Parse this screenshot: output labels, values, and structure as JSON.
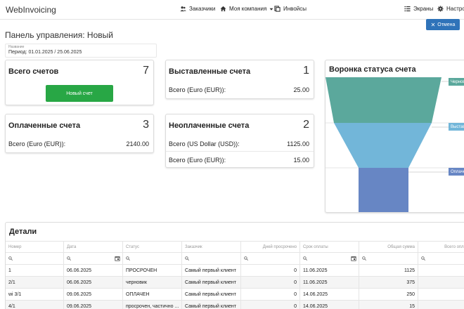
{
  "navbar": {
    "brand": "WebInvoicing",
    "items": [
      {
        "label": "Заказчики",
        "icon": "users-icon"
      },
      {
        "label": "Моя компания",
        "icon": "home-icon",
        "dropdown": true
      },
      {
        "label": "Инвойсы",
        "icon": "documents-icon"
      }
    ],
    "right_items": [
      {
        "label": "Экраны",
        "icon": "list-icon"
      },
      {
        "label": "Настрой",
        "icon": "gear-icon"
      }
    ]
  },
  "page": {
    "title": "Панель управления: Новый",
    "cancel_label": "Отмена",
    "name_field_label": "Название",
    "name_field_value": "Период: 01.01.2025 / 25.06.2025"
  },
  "cards": {
    "total": {
      "title": "Всего счетов",
      "count": "7",
      "button_label": "Новый счет"
    },
    "issued": {
      "title": "Выставленные счета",
      "count": "1",
      "rows": [
        {
          "label": "Всего (Euro (EUR)):",
          "value": "25.00"
        }
      ]
    },
    "paid": {
      "title": "Оплаченные счета",
      "count": "3",
      "rows": [
        {
          "label": "Всего (Euro (EUR)):",
          "value": "2140.00"
        }
      ]
    },
    "unpaid": {
      "title": "Неоплаченные счета",
      "count": "2",
      "rows": [
        {
          "label": "Всего (US Dollar (USD)):",
          "value": "1125.00"
        },
        {
          "label": "Всего (Euro (EUR)):",
          "value": "15.00"
        }
      ]
    }
  },
  "funnel": {
    "title": "Воронка статуса счета",
    "stages": [
      {
        "label": "Черновик",
        "color": "#5ba89c"
      },
      {
        "label": "Выставлен",
        "color": "#72b6d9"
      },
      {
        "label": "Оплачен",
        "color": "#6786c4"
      }
    ]
  },
  "details": {
    "title": "Детали",
    "columns": [
      "Номер",
      "Дата",
      "Статус",
      "Заказчик",
      "Дней просрочено",
      "Срок оплаты",
      "Общая сумма",
      "Всего опла"
    ],
    "rows": [
      [
        "1",
        "06.06.2025",
        "ПРОСРОЧЕН",
        "Самый первый клиент",
        "0",
        "11.06.2025",
        "1125",
        ""
      ],
      [
        "2/1",
        "06.06.2025",
        "черновик",
        "Самый первый клиент",
        "0",
        "11.06.2025",
        "375",
        ""
      ],
      [
        "wi 3/1",
        "09.06.2025",
        "ОПЛАЧЕН",
        "Самый первый клиент",
        "0",
        "14.06.2025",
        "250",
        ""
      ],
      [
        "4/1",
        "09.06.2025",
        "просрочен, частично ...",
        "Самый первый клиент",
        "0",
        "14.06.2025",
        "15",
        ""
      ]
    ]
  }
}
